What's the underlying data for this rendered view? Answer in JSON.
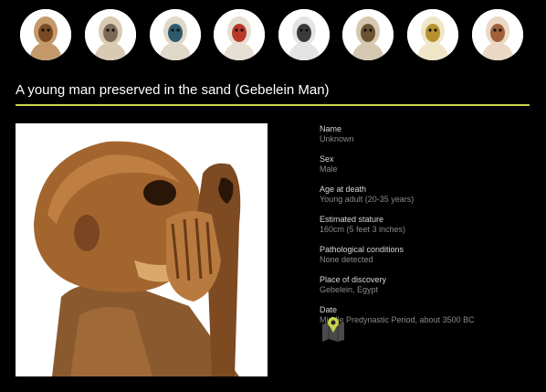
{
  "page": {
    "title": "A young man preserved in the sand (Gebelein Man)"
  },
  "thumbnails": [
    {
      "icon": "gebelein-man-thumb-icon",
      "bg": "#c49a6c",
      "fg": "#7a4a22"
    },
    {
      "icon": "wooden-coffin-thumb-icon",
      "bg": "#d9cbb3",
      "fg": "#7b6a55"
    },
    {
      "icon": "painted-mask-thumb-icon",
      "bg": "#e0d8c8",
      "fg": "#2e5a6b"
    },
    {
      "icon": "red-face-mask-thumb-icon",
      "bg": "#e6e0d4",
      "fg": "#b8382a"
    },
    {
      "icon": "gilded-mask-thumb-icon",
      "bg": "#e4e4e4",
      "fg": "#3a3a3a"
    },
    {
      "icon": "bandaged-mummy-thumb-icon",
      "bg": "#d5c8b0",
      "fg": "#6a5330"
    },
    {
      "icon": "gold-mask-thumb-icon",
      "bg": "#efe6c8",
      "fg": "#b8922e"
    },
    {
      "icon": "skull-thumb-icon",
      "bg": "#ead8c4",
      "fg": "#a0603a"
    }
  ],
  "details": [
    {
      "label": "Name",
      "value": "Unknown"
    },
    {
      "label": "Sex",
      "value": "Male"
    },
    {
      "label": "Age at death",
      "value": "Young adult (20-35 years)"
    },
    {
      "label": "Estimated stature",
      "value": "160cm (5 feet 3 inches)"
    },
    {
      "label": "Pathological conditions",
      "value": "None detected"
    },
    {
      "label": "Place of discovery",
      "value": "Gebelein, Egypt"
    },
    {
      "label": "Date",
      "value": "Middle Predynastic Period, about 3500 BC"
    }
  ],
  "colors": {
    "accent_rule": "#c8d24a",
    "map_pin": "#c8d24a"
  },
  "map_icon": "map-location-icon"
}
